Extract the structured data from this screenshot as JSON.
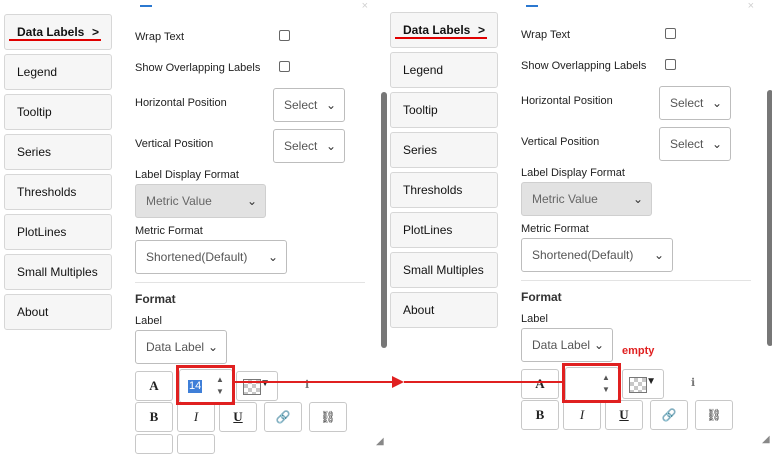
{
  "left": {
    "nav": {
      "active_label": "Data Labels",
      "active_caret": ">",
      "items": [
        "Legend",
        "Tooltip",
        "Series",
        "Thresholds",
        "PlotLines",
        "Small Multiples",
        "About"
      ]
    },
    "content": {
      "wrap_text_label": "Wrap Text",
      "overlap_label": "Show Overlapping Labels",
      "horizontal_label": "Horizontal Position",
      "horizontal_value": "Select",
      "vertical_label": "Vertical Position",
      "vertical_value": "Select",
      "label_format_label": "Label Display Format",
      "label_format_value": "Metric Value",
      "metric_format_label": "Metric Format",
      "metric_format_value": "Shortened(Default)",
      "format_heading": "Format",
      "label_label": "Label",
      "label_value": "Data Label",
      "font_a": "A",
      "font_size": "14",
      "bold": "B",
      "italic": "I",
      "underline": "U"
    }
  },
  "right": {
    "nav": {
      "active_label": "Data Labels",
      "active_caret": ">",
      "items": [
        "Legend",
        "Tooltip",
        "Series",
        "Thresholds",
        "PlotLines",
        "Small Multiples",
        "About"
      ]
    },
    "content": {
      "wrap_text_label": "Wrap Text",
      "overlap_label": "Show Overlapping Labels",
      "horizontal_label": "Horizontal Position",
      "horizontal_value": "Select",
      "vertical_label": "Vertical Position",
      "vertical_value": "Select",
      "label_format_label": "Label Display Format",
      "label_format_value": "Metric Value",
      "metric_format_label": "Metric Format",
      "metric_format_value": "Shortened(Default)",
      "format_heading": "Format",
      "label_label": "Label",
      "label_value": "Data Label",
      "font_a": "A",
      "font_size": "",
      "bold": "B",
      "italic": "I",
      "underline": "U"
    }
  },
  "annotation": {
    "empty_text": "empty",
    "highlight_color": "#e02020"
  },
  "icons": {
    "chevron_down": "⌄",
    "spin_up": "▲",
    "spin_down": "▼",
    "color_dropdown": "▼",
    "info": "ℹ",
    "link": "🔗",
    "unlink": "⛓",
    "resize": "◢",
    "close": "×"
  }
}
